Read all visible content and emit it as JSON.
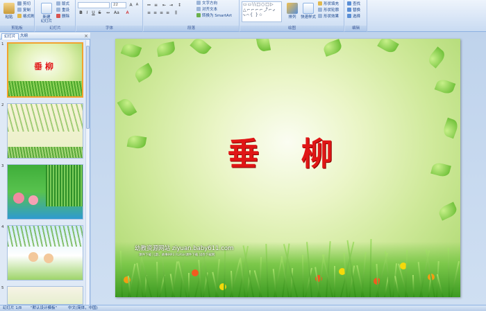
{
  "ribbon": {
    "clipboard": {
      "label": "剪贴板",
      "paste": "粘贴",
      "cut": "剪切",
      "copy": "复制",
      "format_painter": "格式刷"
    },
    "slides": {
      "label": "幻灯片",
      "new_slide_line1": "新建",
      "new_slide_line2": "幻灯片",
      "layout": "版式",
      "reset": "重设",
      "delete": "删除"
    },
    "font": {
      "label": "字体",
      "font_size": "22"
    },
    "paragraph": {
      "label": "段落",
      "text_direction": "文字方向",
      "align_text": "对齐文本",
      "smartart": "转换为 SmartArt"
    },
    "drawing": {
      "label": "绘图",
      "shapes_gallery": "▭▭\\\\□○□▷\n△⌐⌐⌐⌐⤴⌐⤶\n⤷⌒{ }☆",
      "arrange": "排列",
      "quick_styles": "快速样式",
      "shape_fill": "形状填充",
      "shape_outline": "形状轮廓",
      "shape_effects": "形状效果"
    },
    "editing": {
      "label": "编辑",
      "find": "查找",
      "replace": "替换",
      "select": "选择"
    }
  },
  "leftpane": {
    "tab_slides": "幻灯片",
    "tab_outline": "大纲",
    "close": "×",
    "thumbnails": [
      {
        "num": "1",
        "title": "垂柳"
      },
      {
        "num": "2"
      },
      {
        "num": "3"
      },
      {
        "num": "4"
      },
      {
        "num": "5"
      }
    ]
  },
  "slide": {
    "title": "垂 柳",
    "site_line": "幼教资源网站 ziyuan.baby611.com",
    "site_sub": "课件下载  儿歌、故事MP3  FLASH课件下载  试卷下载网"
  },
  "statusbar": {
    "slide_pos": "幻灯片 1/8",
    "theme": "\"默认设计模板\"",
    "lang": "中文(简体，中国)"
  },
  "colors": {
    "title_red": "#e01616",
    "ribbon_blue": "#15428b",
    "selection_orange": "#f2a22e"
  }
}
